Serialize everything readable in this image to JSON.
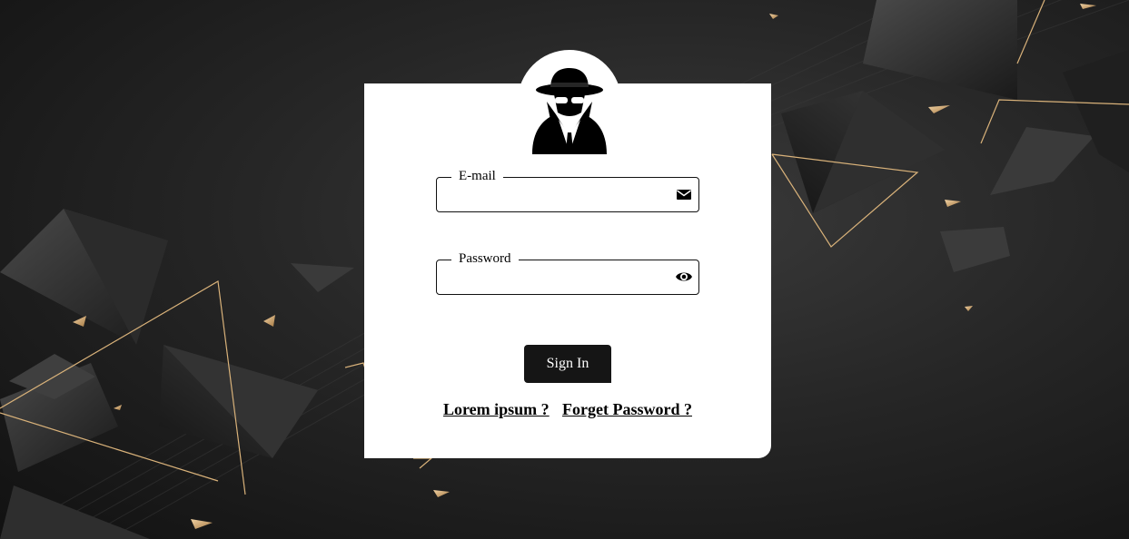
{
  "login": {
    "email_label": "E-mail",
    "email_value": "",
    "password_label": "Password",
    "password_value": "",
    "signin_label": "Sign In"
  },
  "links": {
    "lorem": "Lorem ipsum ?",
    "forget": "Forget Password ?"
  },
  "icons": {
    "avatar": "spy-icon",
    "email": "envelope-icon",
    "password": "eye-icon"
  },
  "colors": {
    "background": "#262626",
    "card": "#ffffff",
    "accent_gold": "#d9b27a",
    "button": "#151515"
  }
}
